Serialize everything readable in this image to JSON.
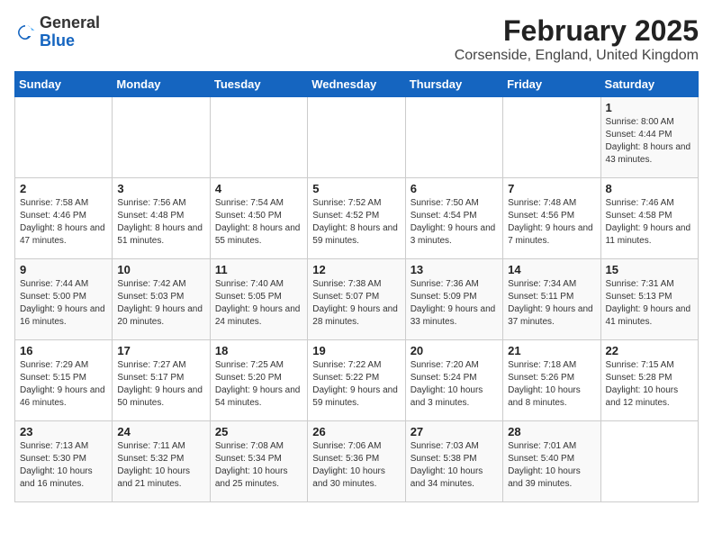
{
  "logo": {
    "general": "General",
    "blue": "Blue"
  },
  "title": "February 2025",
  "subtitle": "Corsenside, England, United Kingdom",
  "headers": [
    "Sunday",
    "Monday",
    "Tuesday",
    "Wednesday",
    "Thursday",
    "Friday",
    "Saturday"
  ],
  "weeks": [
    [
      {
        "day": "",
        "info": ""
      },
      {
        "day": "",
        "info": ""
      },
      {
        "day": "",
        "info": ""
      },
      {
        "day": "",
        "info": ""
      },
      {
        "day": "",
        "info": ""
      },
      {
        "day": "",
        "info": ""
      },
      {
        "day": "1",
        "info": "Sunrise: 8:00 AM\nSunset: 4:44 PM\nDaylight: 8 hours and 43 minutes."
      }
    ],
    [
      {
        "day": "2",
        "info": "Sunrise: 7:58 AM\nSunset: 4:46 PM\nDaylight: 8 hours and 47 minutes."
      },
      {
        "day": "3",
        "info": "Sunrise: 7:56 AM\nSunset: 4:48 PM\nDaylight: 8 hours and 51 minutes."
      },
      {
        "day": "4",
        "info": "Sunrise: 7:54 AM\nSunset: 4:50 PM\nDaylight: 8 hours and 55 minutes."
      },
      {
        "day": "5",
        "info": "Sunrise: 7:52 AM\nSunset: 4:52 PM\nDaylight: 8 hours and 59 minutes."
      },
      {
        "day": "6",
        "info": "Sunrise: 7:50 AM\nSunset: 4:54 PM\nDaylight: 9 hours and 3 minutes."
      },
      {
        "day": "7",
        "info": "Sunrise: 7:48 AM\nSunset: 4:56 PM\nDaylight: 9 hours and 7 minutes."
      },
      {
        "day": "8",
        "info": "Sunrise: 7:46 AM\nSunset: 4:58 PM\nDaylight: 9 hours and 11 minutes."
      }
    ],
    [
      {
        "day": "9",
        "info": "Sunrise: 7:44 AM\nSunset: 5:00 PM\nDaylight: 9 hours and 16 minutes."
      },
      {
        "day": "10",
        "info": "Sunrise: 7:42 AM\nSunset: 5:03 PM\nDaylight: 9 hours and 20 minutes."
      },
      {
        "day": "11",
        "info": "Sunrise: 7:40 AM\nSunset: 5:05 PM\nDaylight: 9 hours and 24 minutes."
      },
      {
        "day": "12",
        "info": "Sunrise: 7:38 AM\nSunset: 5:07 PM\nDaylight: 9 hours and 28 minutes."
      },
      {
        "day": "13",
        "info": "Sunrise: 7:36 AM\nSunset: 5:09 PM\nDaylight: 9 hours and 33 minutes."
      },
      {
        "day": "14",
        "info": "Sunrise: 7:34 AM\nSunset: 5:11 PM\nDaylight: 9 hours and 37 minutes."
      },
      {
        "day": "15",
        "info": "Sunrise: 7:31 AM\nSunset: 5:13 PM\nDaylight: 9 hours and 41 minutes."
      }
    ],
    [
      {
        "day": "16",
        "info": "Sunrise: 7:29 AM\nSunset: 5:15 PM\nDaylight: 9 hours and 46 minutes."
      },
      {
        "day": "17",
        "info": "Sunrise: 7:27 AM\nSunset: 5:17 PM\nDaylight: 9 hours and 50 minutes."
      },
      {
        "day": "18",
        "info": "Sunrise: 7:25 AM\nSunset: 5:20 PM\nDaylight: 9 hours and 54 minutes."
      },
      {
        "day": "19",
        "info": "Sunrise: 7:22 AM\nSunset: 5:22 PM\nDaylight: 9 hours and 59 minutes."
      },
      {
        "day": "20",
        "info": "Sunrise: 7:20 AM\nSunset: 5:24 PM\nDaylight: 10 hours and 3 minutes."
      },
      {
        "day": "21",
        "info": "Sunrise: 7:18 AM\nSunset: 5:26 PM\nDaylight: 10 hours and 8 minutes."
      },
      {
        "day": "22",
        "info": "Sunrise: 7:15 AM\nSunset: 5:28 PM\nDaylight: 10 hours and 12 minutes."
      }
    ],
    [
      {
        "day": "23",
        "info": "Sunrise: 7:13 AM\nSunset: 5:30 PM\nDaylight: 10 hours and 16 minutes."
      },
      {
        "day": "24",
        "info": "Sunrise: 7:11 AM\nSunset: 5:32 PM\nDaylight: 10 hours and 21 minutes."
      },
      {
        "day": "25",
        "info": "Sunrise: 7:08 AM\nSunset: 5:34 PM\nDaylight: 10 hours and 25 minutes."
      },
      {
        "day": "26",
        "info": "Sunrise: 7:06 AM\nSunset: 5:36 PM\nDaylight: 10 hours and 30 minutes."
      },
      {
        "day": "27",
        "info": "Sunrise: 7:03 AM\nSunset: 5:38 PM\nDaylight: 10 hours and 34 minutes."
      },
      {
        "day": "28",
        "info": "Sunrise: 7:01 AM\nSunset: 5:40 PM\nDaylight: 10 hours and 39 minutes."
      },
      {
        "day": "",
        "info": ""
      }
    ]
  ]
}
